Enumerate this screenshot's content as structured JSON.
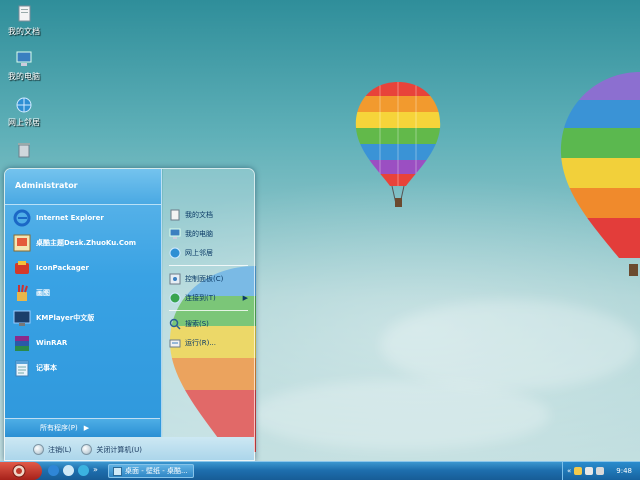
{
  "desktop": {
    "icons": [
      {
        "name": "my-documents",
        "label": "我的文档"
      },
      {
        "name": "my-computer",
        "label": "我的电脑"
      },
      {
        "name": "network-places",
        "label": "网上邻居"
      }
    ]
  },
  "start_menu": {
    "user": "Administrator",
    "programs": [
      {
        "label": "Internet Explorer",
        "icon": "ie-icon"
      },
      {
        "label": "桌酷主题Desk.ZhuoKu.Com",
        "icon": "zhuoku-icon"
      },
      {
        "label": "IconPackager",
        "icon": "iconpackager-icon"
      },
      {
        "label": "画图",
        "icon": "paint-icon"
      },
      {
        "label": "KMPlayer中文版",
        "icon": "kmplayer-icon"
      },
      {
        "label": "WinRAR",
        "icon": "winrar-icon"
      },
      {
        "label": "记事本",
        "icon": "notepad-icon"
      }
    ],
    "all_programs": "所有程序(P)",
    "all_programs_arrow": "▶",
    "right_items": [
      {
        "label": "我的文档",
        "icon": "documents-icon"
      },
      {
        "label": "我的电脑",
        "icon": "computer-icon"
      },
      {
        "label": "网上邻居",
        "icon": "network-icon"
      },
      {
        "label": "控制面板(C)",
        "icon": "control-panel-icon"
      },
      {
        "label": "连接到(T)",
        "icon": "connect-icon",
        "arrow": "▶"
      },
      {
        "label": "搜索(S)",
        "icon": "search-icon"
      },
      {
        "label": "运行(R)...",
        "icon": "run-icon"
      }
    ],
    "logoff": "注销(L)",
    "shutdown": "关闭计算机(U)"
  },
  "taskbar": {
    "quicklaunch_arrow": "»",
    "task_label": "桌面 - 壁纸 - 桌酷...",
    "clock": "9:48",
    "tray_arrow": "«"
  },
  "colors": {
    "accent": "#2f98dc",
    "taskbar": "#1e6fae",
    "start": "#c0392b"
  }
}
